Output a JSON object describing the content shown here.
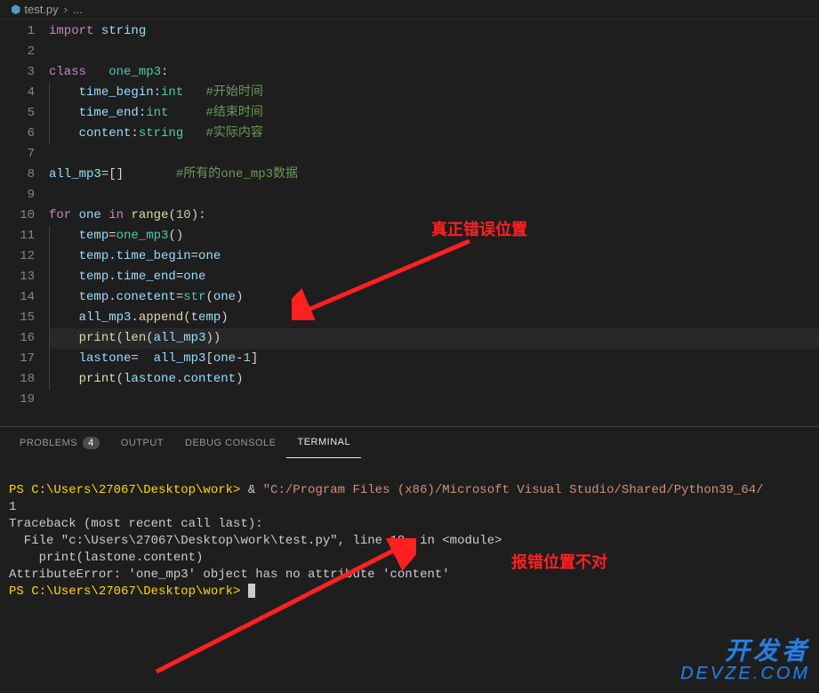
{
  "breadcrumb": {
    "filename": "test.py",
    "sep": "›",
    "rest": "..."
  },
  "code": {
    "lines": [
      {
        "n": "1",
        "html": "<span class='kw'>import</span> <span class='var'>string</span>"
      },
      {
        "n": "2",
        "html": ""
      },
      {
        "n": "3",
        "html": "<span class='kw'>class</span>   <span class='cls'>one_mp3</span>:"
      },
      {
        "n": "4",
        "html": "    <span class='var'>time_begin</span>:<span class='type'>int</span>   <span class='cmt'>#开始时间</span>"
      },
      {
        "n": "5",
        "html": "    <span class='var'>time_end</span>:<span class='type'>int</span>     <span class='cmt'>#结束时间</span>"
      },
      {
        "n": "6",
        "html": "    <span class='var'>content</span>:<span class='builtin'>string</span>   <span class='cmt'>#实际内容</span>"
      },
      {
        "n": "7",
        "html": ""
      },
      {
        "n": "8",
        "html": "<span class='var'>all_mp3</span>=[]       <span class='cmt'>#所有的one_mp3数据</span>"
      },
      {
        "n": "9",
        "html": ""
      },
      {
        "n": "10",
        "html": "<span class='kw'>for</span> <span class='var'>one</span> <span class='kw'>in</span> <span class='fn'>range</span>(<span class='num'>10</span>):"
      },
      {
        "n": "11",
        "html": "    <span class='var'>temp</span>=<span class='cls'>one_mp3</span>()"
      },
      {
        "n": "12",
        "html": "    <span class='var'>temp</span>.<span class='var'>time_begin</span>=<span class='var'>one</span>"
      },
      {
        "n": "13",
        "html": "    <span class='var'>temp</span>.<span class='var'>time_end</span>=<span class='var'>one</span>"
      },
      {
        "n": "14",
        "html": "    <span class='var'>temp</span>.<span class='var'>conetent</span>=<span class='builtin'>str</span>(<span class='var'>one</span>)"
      },
      {
        "n": "15",
        "html": "    <span class='var'>all_mp3</span>.<span class='fn'>append</span>(<span class='var'>temp</span>)"
      },
      {
        "n": "16",
        "html": "    <span class='fn'>print</span>(<span class='fn'>len</span>(<span class='var'>all_mp3</span>))",
        "current": true
      },
      {
        "n": "17",
        "html": "    <span class='var'>lastone</span>=  <span class='var'>all_mp3</span>[<span class='var'>one</span>-<span class='num'>1</span>]"
      },
      {
        "n": "18",
        "html": "    <span class='fn'>print</span>(<span class='var'>lastone</span>.<span class='var'>content</span>)"
      },
      {
        "n": "19",
        "html": ""
      }
    ]
  },
  "panel": {
    "tabs": {
      "problems": "PROBLEMS",
      "problems_count": "4",
      "output": "OUTPUT",
      "debug": "DEBUG CONSOLE",
      "terminal": "TERMINAL"
    }
  },
  "terminal": {
    "line1_prompt": "PS C:\\Users\\27067\\Desktop\\work> ",
    "line1_amp": "&",
    "line1_cmd": " \"C:/Program Files (x86)/Microsoft Visual Studio/Shared/Python39_64/",
    "line2": "1",
    "line3": "Traceback (most recent call last):",
    "line4": "  File \"c:\\Users\\27067\\Desktop\\work\\test.py\", line 18, in <module>",
    "line5": "    print(lastone.content)",
    "line6": "AttributeError: 'one_mp3' object has no attribute 'content'",
    "line7_prompt": "PS C:\\Users\\27067\\Desktop\\work> "
  },
  "annotations": {
    "label1": "真正错误位置",
    "label2": "报错位置不对"
  },
  "watermark": {
    "line1": "开发者",
    "line2": "DEVZE.COM"
  }
}
